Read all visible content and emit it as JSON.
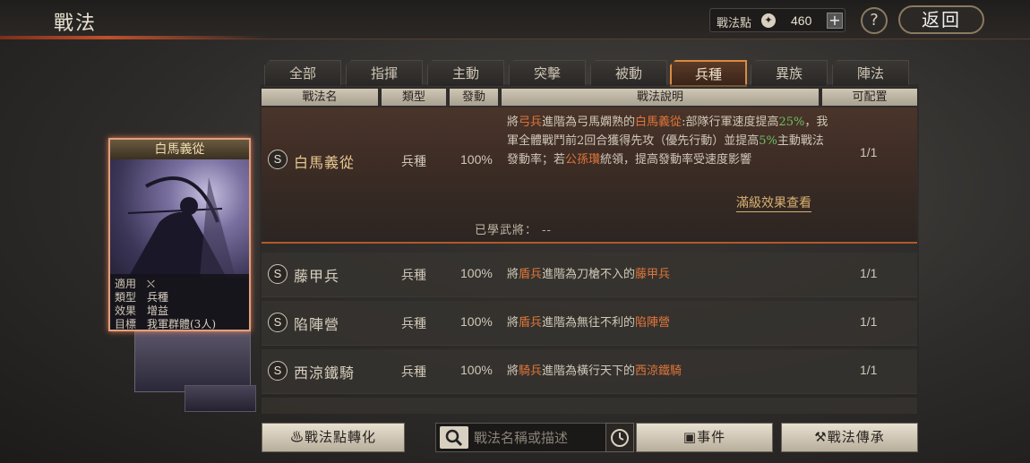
{
  "header": {
    "title": "戰法",
    "points_label": "戰法點",
    "points_value": "460",
    "help_label": "?",
    "back_label": "返回"
  },
  "tabs": [
    "全部",
    "指揮",
    "主動",
    "突擊",
    "被動",
    "兵種",
    "異族",
    "陣法"
  ],
  "active_tab": "兵種",
  "columns": [
    "戰法名",
    "類型",
    "發動",
    "戰法說明",
    "可配置"
  ],
  "rows": [
    {
      "grade": "S",
      "name": "白馬義從",
      "type": "兵種",
      "rate": "100%",
      "config": "1/1",
      "desc_parts": [
        {
          "t": "將",
          "c": ""
        },
        {
          "t": "弓兵",
          "c": "o"
        },
        {
          "t": "進階為弓馬嫻熟的",
          "c": ""
        },
        {
          "t": "白馬義從",
          "c": "o"
        },
        {
          "t": ":部隊行軍速度提高",
          "c": ""
        },
        {
          "t": "25%",
          "c": "g"
        },
        {
          "t": "，我軍全體戰鬥前2回合獲得先攻（優先行動）並提高",
          "c": ""
        },
        {
          "t": "5%",
          "c": "g"
        },
        {
          "t": "主動戰法發動率；若",
          "c": ""
        },
        {
          "t": "公孫瓚",
          "c": "o"
        },
        {
          "t": "統領，提高發動率受速度影響",
          "c": ""
        }
      ],
      "full_effect_link": "滿級效果查看",
      "learned_label": "已學武將：",
      "learned_value": "--"
    },
    {
      "grade": "S",
      "name": "藤甲兵",
      "type": "兵種",
      "rate": "100%",
      "config": "1/1",
      "desc_parts": [
        {
          "t": "將",
          "c": ""
        },
        {
          "t": "盾兵",
          "c": "o"
        },
        {
          "t": "進階為刀槍不入的",
          "c": ""
        },
        {
          "t": "藤甲兵",
          "c": "o"
        }
      ]
    },
    {
      "grade": "S",
      "name": "陷陣營",
      "type": "兵種",
      "rate": "100%",
      "config": "1/1",
      "desc_parts": [
        {
          "t": "將",
          "c": ""
        },
        {
          "t": "盾兵",
          "c": "o"
        },
        {
          "t": "進階為無往不利的",
          "c": ""
        },
        {
          "t": "陷陣營",
          "c": "o"
        }
      ]
    },
    {
      "grade": "S",
      "name": "西涼鐵騎",
      "type": "兵種",
      "rate": "100%",
      "config": "1/1",
      "desc_parts": [
        {
          "t": "將",
          "c": ""
        },
        {
          "t": "騎兵",
          "c": "o"
        },
        {
          "t": "進階為橫行天下的",
          "c": ""
        },
        {
          "t": "西涼鐵騎",
          "c": "o"
        }
      ]
    }
  ],
  "card": {
    "title": "白馬義從",
    "info": [
      {
        "key": "適用",
        "value": "⛌"
      },
      {
        "key": "類型",
        "value": "兵種"
      },
      {
        "key": "效果",
        "value": "增益"
      },
      {
        "key": "目標",
        "value": "我軍群體(3人)"
      }
    ]
  },
  "bottom": {
    "convert_label": "戰法點轉化",
    "search_placeholder": "戰法名稱或描述",
    "event_label": "事件",
    "inherit_label": "戰法傳承"
  },
  "colors": {
    "accent_orange": "#e0763a",
    "accent_green": "#6ec060",
    "active_tab_border": "#d98a40"
  }
}
